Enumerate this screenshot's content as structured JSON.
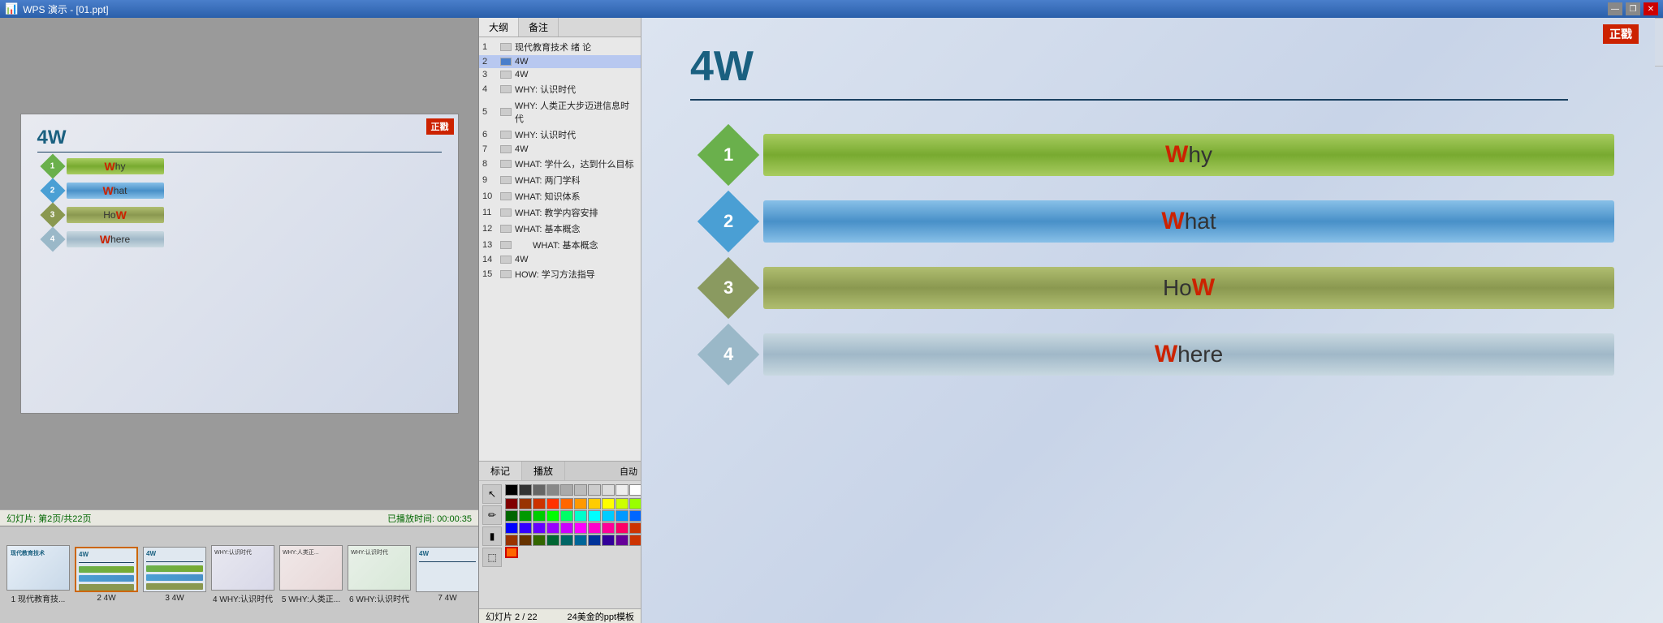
{
  "titleBar": {
    "title": "WPS 演示 - [01.ppt]",
    "minimize": "—",
    "restore": "❐",
    "close": "✕"
  },
  "outlineTabs": [
    "大纲",
    "备注"
  ],
  "outlineItems": [
    {
      "num": "1",
      "hasIcon": true,
      "active": false,
      "text": "现代教育技术  绪 论"
    },
    {
      "num": "2",
      "hasIcon": true,
      "active": true,
      "text": "4W"
    },
    {
      "num": "3",
      "hasIcon": true,
      "active": false,
      "text": "4W"
    },
    {
      "num": "4",
      "hasIcon": true,
      "active": false,
      "text": "WHY: 认识时代"
    },
    {
      "num": "5",
      "hasIcon": true,
      "active": false,
      "text": "WHY: 人类正大步迈进信息时代"
    },
    {
      "num": "6",
      "hasIcon": true,
      "active": false,
      "text": "WHY: 认识时代"
    },
    {
      "num": "7",
      "hasIcon": true,
      "active": false,
      "text": "4W"
    },
    {
      "num": "8",
      "hasIcon": true,
      "active": false,
      "text": "WHAT: 学什么，达到什么目标"
    },
    {
      "num": "9",
      "hasIcon": true,
      "active": false,
      "text": "WHAT: 两门学科"
    },
    {
      "num": "10",
      "hasIcon": true,
      "active": false,
      "text": "WHAT: 知识体系"
    },
    {
      "num": "11",
      "hasIcon": true,
      "active": false,
      "text": "WHAT: 教学内容安排"
    },
    {
      "num": "12",
      "hasIcon": true,
      "active": false,
      "text": "WHAT: 基本概念"
    },
    {
      "num": "13",
      "hasIcon": true,
      "active": false,
      "text": "WHAT: 基本概念"
    },
    {
      "num": "14",
      "hasIcon": true,
      "active": false,
      "text": "4W"
    },
    {
      "num": "15",
      "hasIcon": true,
      "active": false,
      "text": "HOW: 学习方法指导"
    }
  ],
  "slide": {
    "title": "4W",
    "items": [
      {
        "num": "1",
        "color": "green",
        "label": "Why",
        "labelW": "W",
        "labelRest": "hy"
      },
      {
        "num": "2",
        "color": "blue",
        "label": "What",
        "labelW": "W",
        "labelRest": "hat"
      },
      {
        "num": "3",
        "color": "olive",
        "label": "HoW",
        "labelW": "W",
        "labelRest": "Ho",
        "labelEnd": ""
      },
      {
        "num": "4",
        "color": "silver",
        "label": "Where",
        "labelW": "W",
        "labelRest": "here"
      }
    ]
  },
  "annotationTabs": [
    "标记",
    "播放"
  ],
  "statusBar": {
    "slideInfo": "幻灯片: 第2页/共22页",
    "playTime": "已播放时间: 00:00:35",
    "currentSlide": "幻灯片 2 / 22",
    "template": "24美金的ppt模板"
  },
  "thumbnails": [
    {
      "num": "1",
      "label": "1 现代教育技..."
    },
    {
      "num": "2",
      "label": "2 4W"
    },
    {
      "num": "3",
      "label": "3 4W"
    },
    {
      "num": "4",
      "label": "4 WHY:认识时代"
    },
    {
      "num": "5",
      "label": "5 WHY:人类正..."
    },
    {
      "num": "6",
      "label": "6 WHY:认识时代"
    },
    {
      "num": "7",
      "label": "7 4W"
    }
  ],
  "colors": {
    "palette": [
      "#000000",
      "#333333",
      "#555555",
      "#777777",
      "#999999",
      "#bbbbbb",
      "#cccccc",
      "#dddddd",
      "#eeeeee",
      "#ffffff",
      "#663300",
      "#993300",
      "#cc3300",
      "#ff3300",
      "#ff6600",
      "#ff9900",
      "#ffcc00",
      "#ffff00",
      "#ccff00",
      "#99ff00",
      "#006600",
      "#009900",
      "#00cc00",
      "#00ff00",
      "#00ff66",
      "#00ffcc",
      "#00ffff",
      "#00ccff",
      "#0099ff",
      "#0066ff",
      "#0000ff",
      "#3300ff",
      "#6600ff",
      "#9900ff",
      "#cc00ff",
      "#ff00ff",
      "#ff00cc",
      "#ff0099",
      "#ff0066",
      "#ff0033",
      "#660000",
      "#003366",
      "#336699",
      "#6699cc",
      "#99ccff",
      "#ccffff",
      "#ffffcc",
      "#ffcc99",
      "#ff9966",
      "#ff6633",
      "#cc6600",
      "#996600",
      "#666600",
      "#336600",
      "#006633",
      "#006666",
      "#006699",
      "#003399",
      "#330099",
      "#660099"
    ]
  }
}
